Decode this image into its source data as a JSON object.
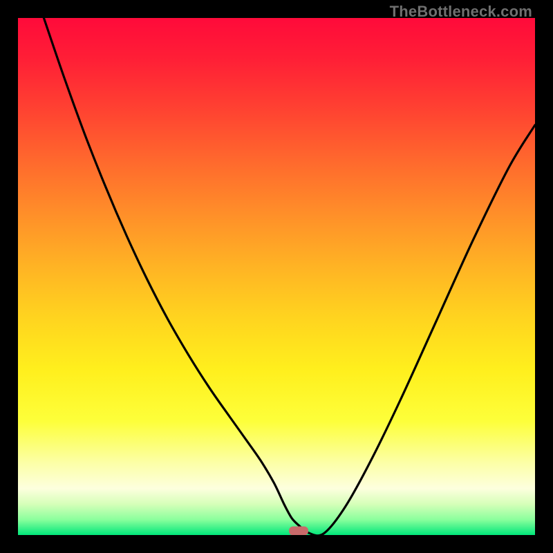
{
  "watermark": "TheBottleneck.com",
  "chart_data": {
    "type": "line",
    "title": "",
    "xlabel": "",
    "ylabel": "",
    "xlim": [
      0,
      1
    ],
    "ylim": [
      0,
      1
    ],
    "series": [
      {
        "name": "curve",
        "x": [
          0.05,
          0.09,
          0.13,
          0.17,
          0.21,
          0.25,
          0.29,
          0.33,
          0.37,
          0.41,
          0.44,
          0.47,
          0.495,
          0.515,
          0.53,
          0.545,
          0.56,
          0.59,
          0.63,
          0.68,
          0.74,
          0.81,
          0.88,
          0.95,
          1.0
        ],
        "y": [
          1.0,
          0.883,
          0.773,
          0.672,
          0.579,
          0.494,
          0.417,
          0.348,
          0.285,
          0.228,
          0.186,
          0.143,
          0.101,
          0.059,
          0.032,
          0.017,
          0.005,
          0.002,
          0.05,
          0.139,
          0.262,
          0.416,
          0.57,
          0.712,
          0.793
        ]
      }
    ],
    "marker": {
      "x": 0.543,
      "y": 0.008
    },
    "gradient_stops": [
      {
        "pos": 0.0,
        "color": "#ff0a3a"
      },
      {
        "pos": 0.5,
        "color": "#ffd41f"
      },
      {
        "pos": 0.78,
        "color": "#fdff3a"
      },
      {
        "pos": 1.0,
        "color": "#00e77a"
      }
    ]
  }
}
